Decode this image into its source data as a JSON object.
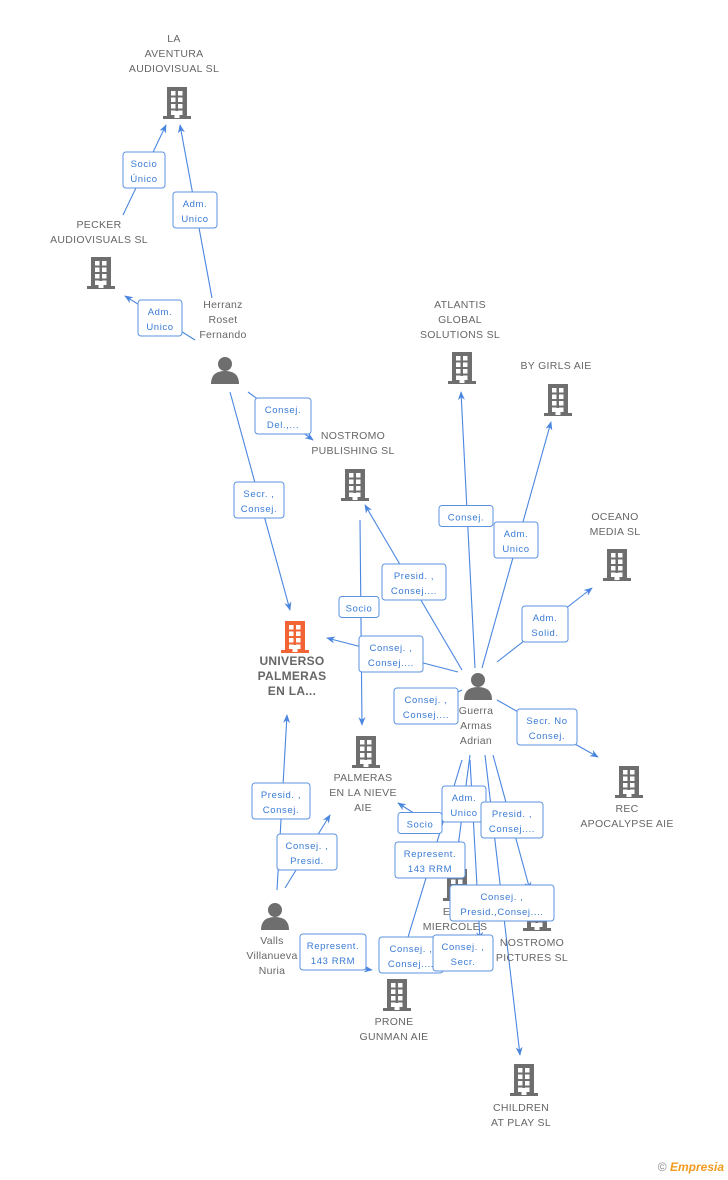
{
  "colors": {
    "main_node": "#f26335",
    "node": "#6e6e6e",
    "edge": "#4a86e0"
  },
  "nodes": {
    "aventura": {
      "type": "company",
      "label": [
        "LA",
        "AVENTURA",
        "AUDIOVISUAL SL"
      ]
    },
    "pecker": {
      "type": "company",
      "label": [
        "PECKER",
        "AUDIOVISUALS SL"
      ]
    },
    "herranz": {
      "type": "person",
      "label": [
        "Herranz",
        "Roset",
        "Fernando"
      ]
    },
    "atlantis": {
      "type": "company",
      "label": [
        "ATLANTIS",
        "GLOBAL",
        "SOLUTIONS SL"
      ]
    },
    "bygirls": {
      "type": "company",
      "label": [
        "BY GIRLS  AIE"
      ]
    },
    "nostromo_pub": {
      "type": "company",
      "label": [
        "NOSTROMO",
        "PUBLISHING SL"
      ]
    },
    "oceano": {
      "type": "company",
      "label": [
        "OCEANO",
        "MEDIA SL"
      ]
    },
    "universo": {
      "type": "main",
      "label": [
        "UNIVERSO",
        "PALMERAS",
        "EN LA..."
      ]
    },
    "guerra": {
      "type": "person",
      "label": [
        "Guerra",
        "Armas",
        "Adrian"
      ]
    },
    "palmeras": {
      "type": "company",
      "label": [
        "PALMERAS",
        "EN LA NIEVE",
        "AIE"
      ]
    },
    "rec": {
      "type": "company",
      "label": [
        "REC",
        "APOCALYPSE AIE"
      ]
    },
    "elc": {
      "type": "company",
      "label": [
        "EL C",
        "MIERCOLES",
        "SL"
      ]
    },
    "nostromo_pic": {
      "type": "company",
      "label": [
        "NOSTROMO",
        "PICTURES  SL"
      ]
    },
    "valls": {
      "type": "person",
      "label": [
        "Valls",
        "Villanueva",
        "Nuria"
      ]
    },
    "prone": {
      "type": "company",
      "label": [
        "PRONE",
        "GUNMAN AIE"
      ]
    },
    "children": {
      "type": "company",
      "label": [
        "CHILDREN",
        "AT PLAY SL"
      ]
    }
  },
  "edges": [
    {
      "from": "pecker",
      "to": "aventura",
      "label": [
        "Socio",
        "Único"
      ]
    },
    {
      "from": "herranz",
      "to": "aventura",
      "label": [
        "Adm.",
        "Unico"
      ]
    },
    {
      "from": "herranz",
      "to": "pecker",
      "label": [
        "Adm.",
        "Unico"
      ]
    },
    {
      "from": "herranz",
      "to": "nostromo_pub",
      "label": [
        "Consej.",
        "Del.,..."
      ]
    },
    {
      "from": "herranz",
      "to": "universo",
      "label": [
        "Secr. ,",
        "Consej."
      ]
    },
    {
      "from": "guerra",
      "to": "atlantis",
      "label": [
        "Consej."
      ]
    },
    {
      "from": "guerra",
      "to": "bygirls",
      "label": [
        "Adm.",
        "Unico"
      ]
    },
    {
      "from": "guerra",
      "to": "nostromo_pub",
      "label": [
        "Presid. ,",
        "Consej...."
      ]
    },
    {
      "from": "guerra",
      "to": "oceano",
      "label": [
        "Adm.",
        "Solid."
      ]
    },
    {
      "from": "nostromo_pub",
      "to": "palmeras",
      "label": [
        "Socio"
      ]
    },
    {
      "from": "guerra",
      "to": "universo",
      "label": [
        "Consej. ,",
        "Consej...."
      ]
    },
    {
      "from": "guerra",
      "to": "palmeras",
      "label": [
        "Consej. ,",
        "Consej...."
      ]
    },
    {
      "from": "guerra",
      "to": "rec",
      "label": [
        "Secr.  No",
        "Consej."
      ]
    },
    {
      "from": "guerra",
      "to": "elc",
      "label": [
        "Adm.",
        "Unico"
      ]
    },
    {
      "from": "guerra",
      "to": "nostromo_pic",
      "label": [
        "Presid. ,",
        "Consej...."
      ]
    },
    {
      "from": "elc",
      "to": "palmeras",
      "label": [
        "Socio"
      ]
    },
    {
      "from": "guerra",
      "to": "prone",
      "label": [
        "Represent.",
        "143 RRM"
      ]
    },
    {
      "from": "guerra",
      "to": "children",
      "label": [
        "Consej. ,",
        "Presid.,Consej...."
      ]
    },
    {
      "from": "elc",
      "to": "prone",
      "label": [
        "Consej. ,",
        "Consej...."
      ]
    },
    {
      "from": "guerra",
      "to": "elc",
      "label": [
        "Consej. ,",
        "Secr."
      ]
    },
    {
      "from": "valls",
      "to": "universo",
      "label": [
        "Presid. ,",
        "Consej."
      ]
    },
    {
      "from": "valls",
      "to": "palmeras",
      "label": [
        "Consej. ,",
        "Presid."
      ]
    },
    {
      "from": "valls",
      "to": "prone",
      "label": [
        "Represent.",
        "143 RRM"
      ]
    }
  ],
  "brand": {
    "copyright": "©",
    "name": "Empresia"
  }
}
